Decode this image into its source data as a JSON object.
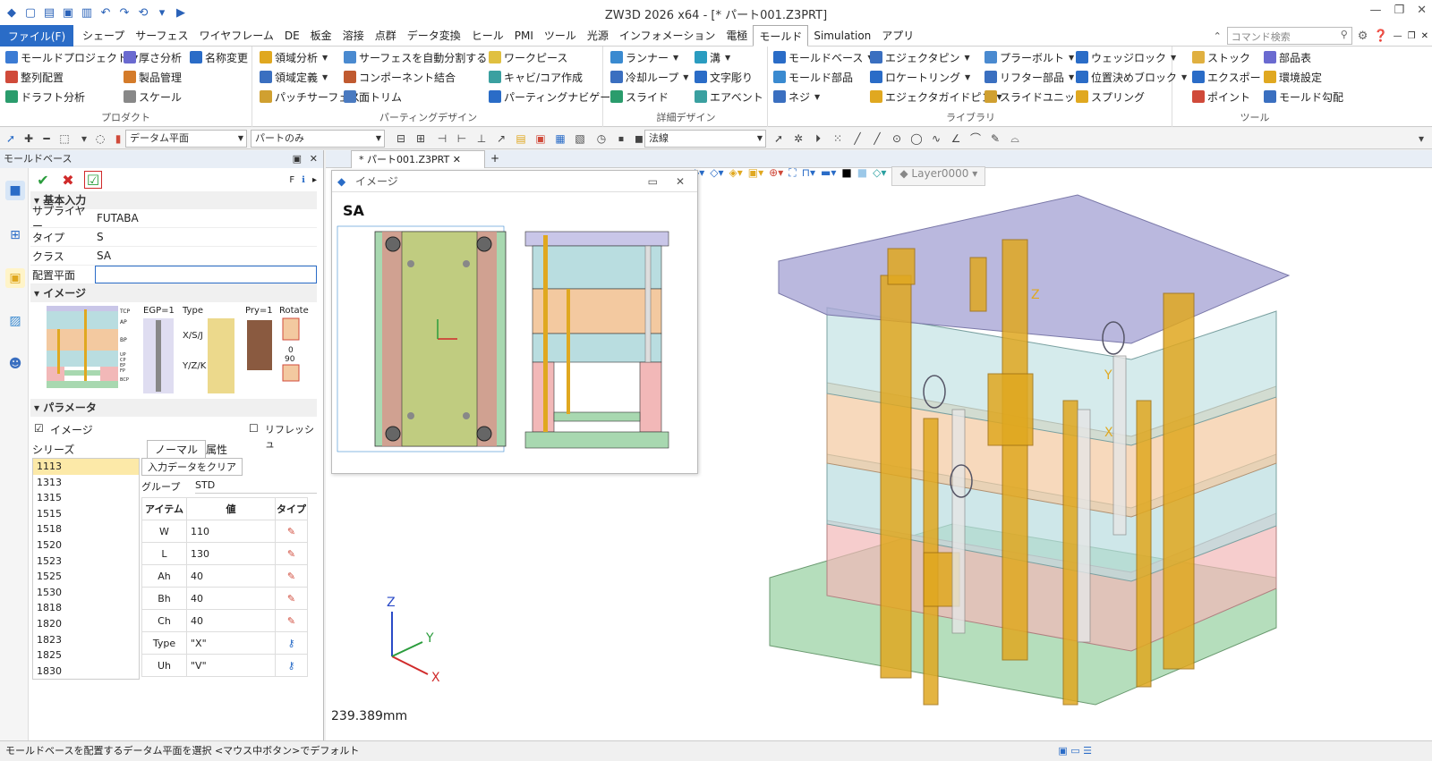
{
  "app": {
    "title": "ZW3D 2026 x64 - [* パート001.Z3PRT]",
    "file_menu": "ファイル(F)"
  },
  "menu_tabs": [
    "シェープ",
    "サーフェス",
    "ワイヤフレーム",
    "DE",
    "板金",
    "溶接",
    "点群",
    "データ変換",
    "ヒール",
    "PMI",
    "ツール",
    "光源",
    "インフォメーション",
    "電極",
    "モールド",
    "Simulation",
    "アプリ"
  ],
  "active_tab": "モールド",
  "search": {
    "placeholder": "コマンド検索"
  },
  "ribbon": {
    "product": {
      "label": "プロダクト",
      "items": [
        "モールドプロジェクト",
        "厚さ分析",
        "名称変更",
        "整列配置",
        "製品管理",
        "ドラフト分析",
        "スケール"
      ]
    },
    "parting": {
      "label": "パーティングデザイン",
      "items": [
        "領域分析",
        "サーフェスを自動分割する",
        "ワークピース",
        "領域定義",
        "コンポーネント結合",
        "キャビ/コア作成",
        "パッチサーフェス",
        "面トリム",
        "パーティングナビゲータ"
      ]
    },
    "detail": {
      "label": "詳細デザイン",
      "items": [
        "ランナー",
        "溝",
        "冷却ループ",
        "文字彫り",
        "スライド",
        "エアベント"
      ]
    },
    "library": {
      "label": "ライブラリ",
      "items": [
        "モールドベース",
        "エジェクタピン",
        "プラーボルト",
        "ウェッジロック",
        "モールド部品",
        "ロケートリング",
        "リフター部品",
        "位置決めブロック",
        "ネジ",
        "エジェクタガイドピン",
        "スライドユニット",
        "スプリング"
      ]
    },
    "tools": {
      "label": "ツール",
      "items": [
        "ストック",
        "部品表",
        "エクスポート",
        "環境設定",
        "ポイント",
        "モールド勾配"
      ]
    }
  },
  "toolbar2": {
    "datum_combo": "データム平面",
    "filter_combo": "パートのみ",
    "normal_combo": "法線"
  },
  "panel": {
    "title": "モールドベース",
    "section_basic": "基本入力",
    "fields": [
      {
        "label": "サプライヤー",
        "value": "FUTABA"
      },
      {
        "label": "タイプ",
        "value": "S"
      },
      {
        "label": "クラス",
        "value": "SA"
      },
      {
        "label": "配置平面",
        "value": ""
      }
    ],
    "section_image": "イメージ",
    "image_labels": {
      "egp": "EGP=1",
      "type": "Type",
      "pry": "Pry=1",
      "rotate": "Rotate",
      "xsj": "X/S/J",
      "yzk": "Y/Z/K",
      "rot0": "0",
      "rot90": "90",
      "tcp": "TCP",
      "ap": "AP",
      "bp": "BP",
      "up": "UP",
      "cp": "CP",
      "ep": "EP",
      "fp": "FP",
      "bcp": "BCP"
    },
    "section_params": "パラメータ",
    "image_checkbox": "イメージ",
    "refresh_checkbox": "リフレッシュ",
    "series_label": "シリーズ",
    "series": [
      "1113",
      "1313",
      "1315",
      "1515",
      "1518",
      "1520",
      "1523",
      "1525",
      "1530",
      "1818",
      "1820",
      "1823",
      "1825",
      "1830"
    ],
    "selected_series": "1113",
    "tab_normal": "ノーマル",
    "tab_attr": "属性",
    "clear_button": "入力データをクリア",
    "group_label": "グループ",
    "group_value": "STD",
    "col_item": "アイテム",
    "col_value": "値",
    "col_type": "タイプ",
    "params": [
      {
        "item": "W",
        "value": "110"
      },
      {
        "item": "L",
        "value": "130"
      },
      {
        "item": "Ah",
        "value": "40"
      },
      {
        "item": "Bh",
        "value": "40"
      },
      {
        "item": "Ch",
        "value": "40"
      },
      {
        "item": "Type",
        "value": "\"X\""
      },
      {
        "item": "Uh",
        "value": "\"V\""
      }
    ]
  },
  "viewport": {
    "doc_tab": "* パート001.Z3PRT",
    "popup_title": "イメージ",
    "drawing_title": "SA",
    "layer": "Layer0000",
    "measurement": "239.389mm",
    "axis_x": "X",
    "axis_y": "Y",
    "axis_z": "Z"
  },
  "status": {
    "message": "モールドベースを配置するデータム平面を選択  <マウス中ボタン>でデフォルト"
  },
  "colors": {
    "accent": "#2a6cc7",
    "plate_top": "#a9a6d6",
    "plate_green": "#a8d8b0",
    "plate_orange": "#f3c9a0",
    "plate_pink": "#f2b8b8",
    "plate_blue": "#b9dde0",
    "pin_gold": "#e0a820"
  }
}
